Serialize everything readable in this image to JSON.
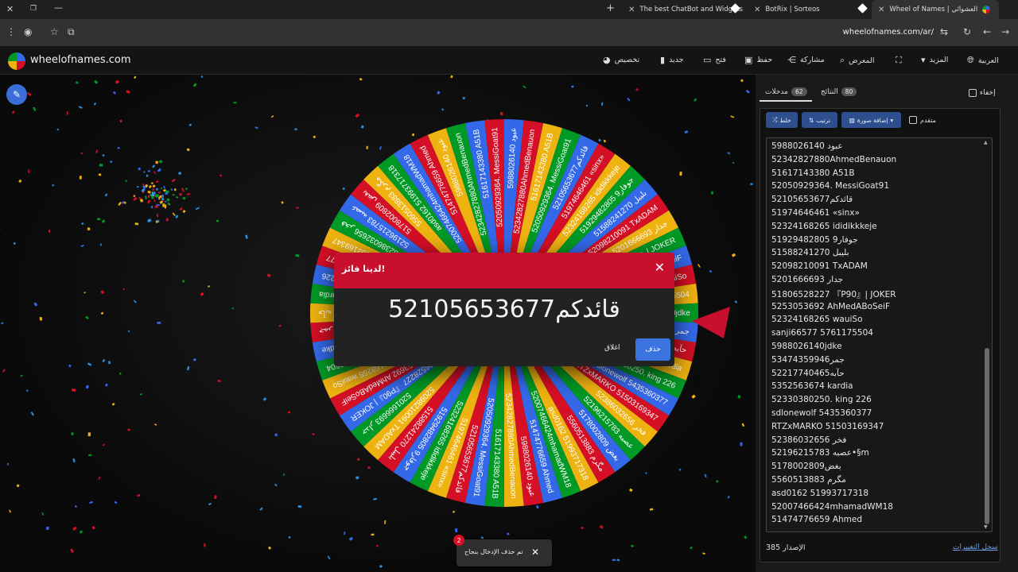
{
  "browser": {
    "tabs": [
      {
        "title": "The best ChatBot and Widgets",
        "active": false
      },
      {
        "title": "BotRix | Sorteos",
        "active": false
      },
      {
        "title": "Wheel of Names | العشوائي",
        "active": true
      }
    ],
    "url": "wheelofnames.com/ar/"
  },
  "header": {
    "brand": "wheelofnames.com",
    "menu": {
      "customize": "تخصيص",
      "new": "جديد",
      "open": "فتح",
      "save": "حفظ",
      "share": "مشاركة",
      "gallery": "المعرض",
      "more": "المزيد",
      "language": "العربية"
    }
  },
  "wheel": {
    "colors": [
      "#3369e8",
      "#d50f25",
      "#eeb211",
      "#009925"
    ],
    "pointer_color": "#c8102e",
    "segment_labels": [
      "5988026140 عبود",
      "52342827880AhmedBenauon",
      "51617143380 A51B",
      "52050929364. MessiGoat91",
      "52105653677قائدكم",
      "51974646461 «sinx»",
      "52324168265 ididikkkeje",
      "51929482805 جوفار9",
      "51588241270 بليبل",
      "52098210091 TxADAM",
      "5201666693 جدار",
      "51806528227 『P90』| JOKER",
      "5253053692 AhMedABoSeiF",
      "52324168265 wauiSo",
      "sanji66577 5761175504",
      "5988026140jdke",
      "53474359946 جمر",
      "52217740465 حآبه",
      "5352563674 kardia",
      "52330380250. king 226",
      "sdlonewolf 5435360377",
      "RTZxMARKO 51503169347",
      "فخر 52386032656",
      "52196215783 عصبه",
      "5178002809 بغض",
      "5560513883 مگرم",
      "asd0162 51993717318",
      "52007466424mhamadWM18",
      "51474776659 Ahmed"
    ]
  },
  "modal": {
    "title": "لدينا فائز!",
    "winner": "52105653677قائدكم",
    "delete_label": "حذف",
    "close_label": "اغلاق"
  },
  "toast": {
    "badge": "2",
    "message": "تم حذف الإدخال بنجاح"
  },
  "panel": {
    "hide_label": "إخفاء",
    "tabs": {
      "entries_label": "مدخلات",
      "entries_count": "62",
      "results_label": "النتائج",
      "results_count": "80"
    },
    "toolbar": {
      "shuffle": "خلط",
      "sort": "ترتيب",
      "add_image": "إضافة صورة",
      "advanced": "متقدم"
    },
    "entries": [
      "5988026140 عبود",
      "52342827880AhmedBenauon",
      "51617143380 A51B",
      "52050929364. MessiGoat91",
      "52105653677قائدكم",
      "51974646461 «sinx»",
      "52324168265 ididikkkeje",
      "51929482805 جوفار9",
      "51588241270 بليبل",
      "52098210091 TxADAM",
      "5201666693 جدار",
      "51806528227 『P90』| JOKER",
      "5253053692 AhMedABoSeiF",
      "52324168265 wauiSo",
      "sanji66577 5761175504",
      "5988026140jdke",
      "53474359946جمر",
      "52217740465حآبه",
      "5352563674 kardia",
      "52330380250. king 226",
      "sdlonewolf 5435360377",
      "RTZxMARKO 51503169347",
      "فخر 52386032656",
      "52196215783 عصبه•§m",
      "5178002809بغض",
      "5560513883 مگرم",
      "asd0162 51993717318",
      "52007466424mhamadWM18",
      "51474776659 Ahmed"
    ],
    "version_label": "الإصدار",
    "version_number": "385",
    "changelog": "سجل التغييرات"
  }
}
